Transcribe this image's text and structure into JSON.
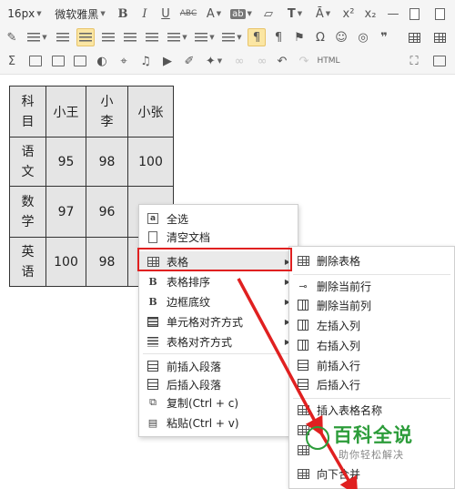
{
  "toolbar": {
    "font_size": "16px",
    "font_family": "微软雅黑",
    "html_label": "HTML"
  },
  "table": {
    "header": [
      "科目",
      "小王",
      "小李",
      "小张"
    ],
    "rows": [
      [
        "语文",
        "95",
        "98",
        "100"
      ],
      [
        "数学",
        "97",
        "96",
        ""
      ],
      [
        "英语",
        "100",
        "98",
        ""
      ]
    ]
  },
  "context_menu": {
    "items": [
      {
        "label": "全选",
        "icon": "select-all-icon"
      },
      {
        "label": "清空文档",
        "icon": "document-icon"
      },
      {
        "label": "表格",
        "icon": "table-icon"
      },
      {
        "label": "表格排序",
        "icon": "bold-b-icon"
      },
      {
        "label": "边框底纹",
        "icon": "bold-b-icon"
      },
      {
        "label": "单元格对齐方式",
        "icon": "align-icon"
      },
      {
        "label": "表格对齐方式",
        "icon": "align-icon"
      },
      {
        "label": "前插入段落",
        "icon": "insert-paragraph-icon"
      },
      {
        "label": "后插入段落",
        "icon": "insert-paragraph-icon"
      },
      {
        "label": "复制(Ctrl + c)",
        "icon": "copy-icon"
      },
      {
        "label": "粘贴(Ctrl + v)",
        "icon": "paste-icon"
      }
    ]
  },
  "submenu": {
    "items": [
      {
        "label": "删除表格"
      },
      {
        "label": "删除当前行"
      },
      {
        "label": "删除当前列"
      },
      {
        "label": "左插入列"
      },
      {
        "label": "右插入列"
      },
      {
        "label": "前插入行"
      },
      {
        "label": "后插入行"
      },
      {
        "label": "插入表格名称"
      },
      {
        "label": "向下合并"
      }
    ]
  },
  "watermark": {
    "title": "百科全说",
    "subtitle": "助你轻松解决"
  },
  "colors": {
    "highlight_red": "#e02020",
    "watermark_green": "#2c9c3a",
    "active_button": "#fbe6a3"
  }
}
